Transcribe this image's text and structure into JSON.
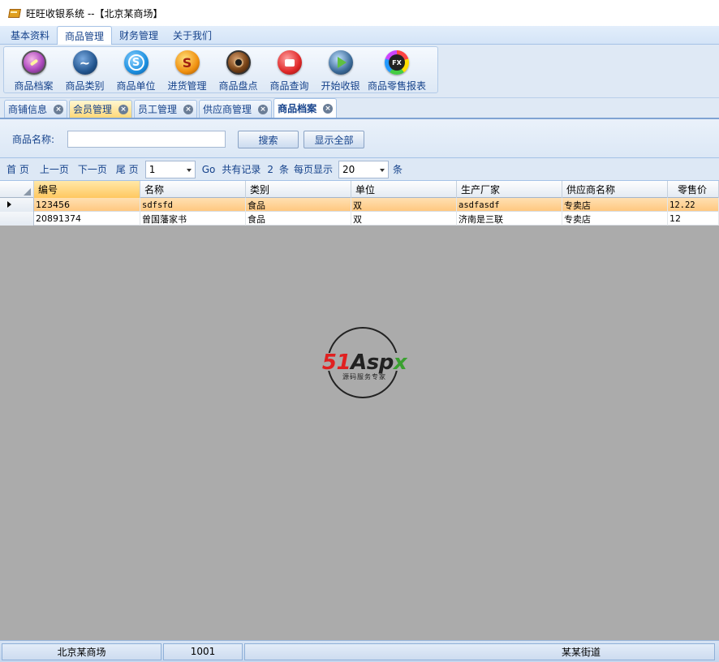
{
  "window": {
    "title": "旺旺收银系统 --【北京某商场】",
    "icon": "wallet-icon"
  },
  "menu": {
    "tabs": [
      {
        "label": "基本资料",
        "active": false
      },
      {
        "label": "商品管理",
        "active": true
      },
      {
        "label": "财务管理",
        "active": false
      },
      {
        "label": "关于我们",
        "active": false
      }
    ]
  },
  "ribbon": {
    "buttons": [
      {
        "label": "商品档案",
        "icon": "product-archive-icon"
      },
      {
        "label": "商品类别",
        "icon": "product-category-icon"
      },
      {
        "label": "商品单位",
        "icon": "product-unit-icon"
      },
      {
        "label": "进货管理",
        "icon": "purchase-icon"
      },
      {
        "label": "商品盘点",
        "icon": "inventory-icon"
      },
      {
        "label": "商品查询",
        "icon": "product-query-icon"
      },
      {
        "label": "开始收银",
        "icon": "start-cashier-icon"
      },
      {
        "label": "商品零售报表",
        "icon": "retail-report-icon"
      }
    ]
  },
  "doc_tabs": [
    {
      "label": "商铺信息",
      "active": false
    },
    {
      "label": "会员管理",
      "active": false
    },
    {
      "label": "员工管理",
      "active": false
    },
    {
      "label": "供应商管理",
      "active": false
    },
    {
      "label": "商品档案",
      "active": true
    }
  ],
  "search": {
    "label": "商品名称:",
    "value": "",
    "search_button": "搜索",
    "show_all_button": "显示全部"
  },
  "pager": {
    "first": "首 页",
    "prev": "上一页",
    "next": "下一页",
    "last": "尾 页",
    "page": "1",
    "go": "Go",
    "total_prefix": "共有记录",
    "total": "2",
    "total_suffix": "条",
    "per_page_prefix": "每页显示",
    "per_page": "20",
    "per_page_suffix": "条"
  },
  "grid": {
    "columns": [
      "编号",
      "名称",
      "类别",
      "单位",
      "生产厂家",
      "供应商名称",
      "零售价"
    ],
    "rows": [
      [
        "123456",
        "sdfsfd",
        "食品",
        "双",
        "asdfasdf",
        "专卖店",
        "12.22"
      ],
      [
        "20891374",
        "曾国藩家书",
        "食品",
        "双",
        "济南是三联",
        "专卖店",
        "12"
      ]
    ],
    "selected_row": 0
  },
  "watermark": {
    "brand_51": "51",
    "brand_asp": "Asp",
    "brand_x": "x",
    "slogan": "源码服务专家"
  },
  "status": {
    "store": "北京某商场",
    "user": "1001",
    "address": "某某街道"
  }
}
